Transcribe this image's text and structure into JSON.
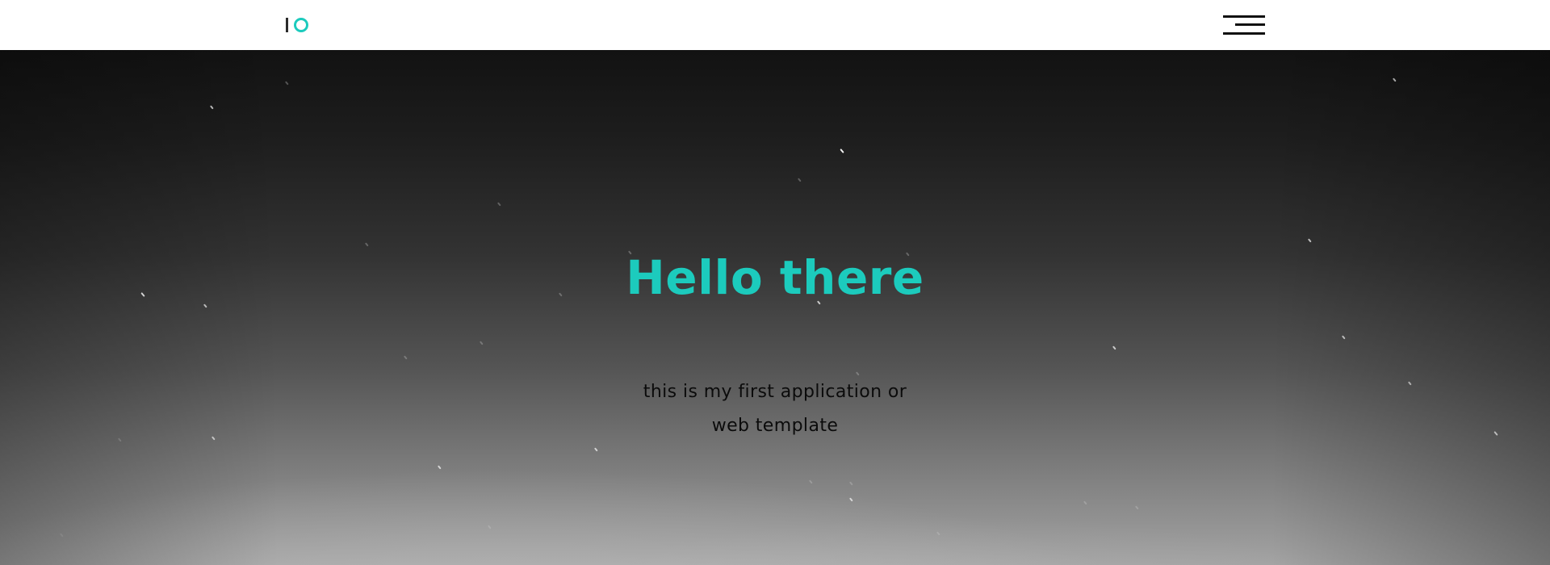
{
  "navbar": {
    "logo": "IO",
    "menu_icon": "hamburger-menu-icon"
  },
  "hero": {
    "title": "Hello there",
    "subtitle": "this is my first application or web template",
    "background": "starry-night-sky"
  },
  "colors": {
    "accent": "#1ccbbd",
    "navbar_bg": "#ffffff",
    "menu_icon": "#111111",
    "subtitle_text": "#0b0b0b"
  }
}
